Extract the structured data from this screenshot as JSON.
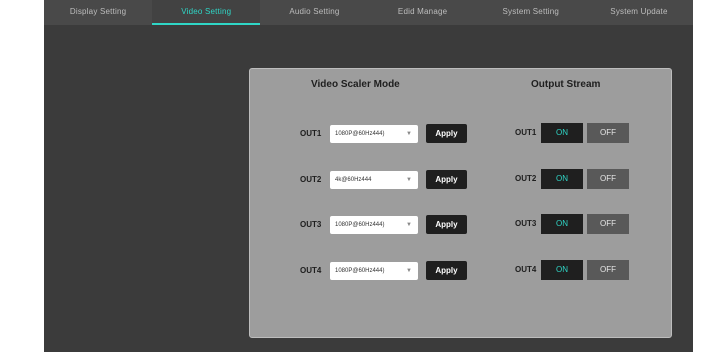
{
  "tabs": [
    {
      "label": "Display Setting"
    },
    {
      "label": "Video Setting"
    },
    {
      "label": "Audio Setting"
    },
    {
      "label": "Edid Manage"
    },
    {
      "label": "System Setting"
    },
    {
      "label": "System Update"
    }
  ],
  "active_tab": "Video Setting",
  "accent_color": "#2fd6c6",
  "panel": {
    "scaler_title": "Video Scaler Mode",
    "stream_title": "Output Stream",
    "apply_label": "Apply",
    "on_label": "ON",
    "off_label": "OFF",
    "dropdown_icon": "chevron-down-icon",
    "outputs": [
      {
        "label": "OUT1",
        "mode": "1080P@60Hz444)",
        "stream": "ON"
      },
      {
        "label": "OUT2",
        "mode": "4k@60Hz444",
        "stream": "ON"
      },
      {
        "label": "OUT3",
        "mode": "1080P@60Hz444)",
        "stream": "ON"
      },
      {
        "label": "OUT4",
        "mode": "1080P@60Hz444)",
        "stream": "ON"
      }
    ]
  }
}
